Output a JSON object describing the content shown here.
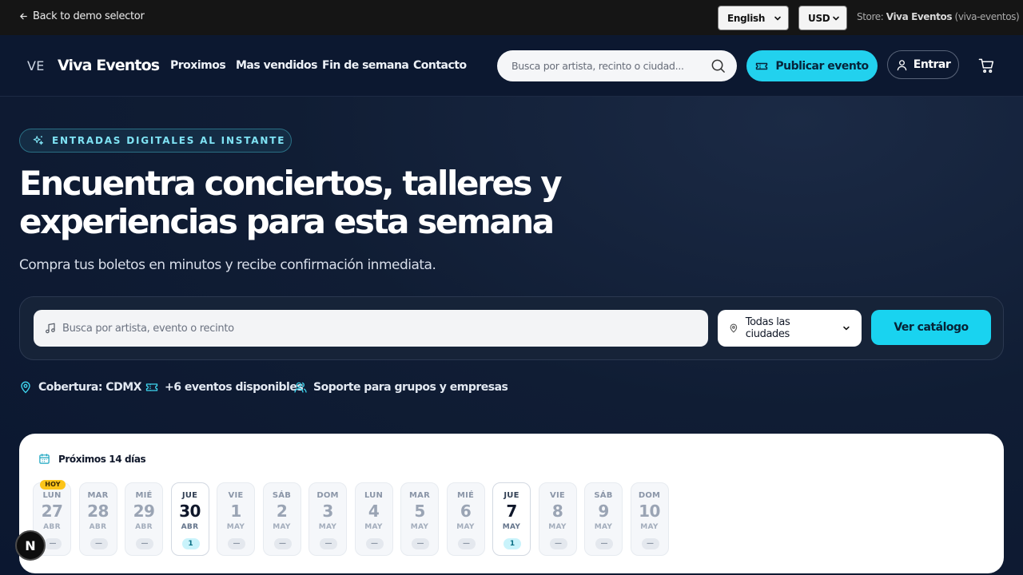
{
  "topbar": {
    "back_label": "Back to demo selector",
    "language": "English",
    "currency": "USD",
    "store_prefix": "Store:",
    "store_name": "Viva Eventos",
    "store_slug": "(viva-eventos)"
  },
  "navbar": {
    "logo_mark": "VE",
    "logo_name": "Viva Eventos",
    "links": [
      "Proximos",
      "Mas vendidos",
      "Fin de semana",
      "Contacto"
    ],
    "search_placeholder": "Busca por artista, recinto o ciudad...",
    "publish_label": "Publicar evento",
    "login_label": "Entrar"
  },
  "hero": {
    "badge": "ENTRADAS DIGITALES AL INSTANTE",
    "title_line1": "Encuentra conciertos, talleres y",
    "title_line2": "experiencias para esta semana",
    "subtitle": "Compra tus boletos en minutos y recibe confirmación inmediata.",
    "search_placeholder": "Busca por artista, evento o recinto",
    "city_selected": "Todas las ciudades",
    "catalog_label": "Ver catálogo",
    "info": [
      "Cobertura: CDMX",
      "+6 eventos disponibles",
      "Soporte para grupos y empresas"
    ]
  },
  "calendar": {
    "title": "Próximos 14 días",
    "today_label": "HOY",
    "days": [
      {
        "dow": "LUN",
        "num": "27",
        "mon": "ABR",
        "count": "—",
        "active": false,
        "today": true
      },
      {
        "dow": "MAR",
        "num": "28",
        "mon": "ABR",
        "count": "—",
        "active": false,
        "today": false
      },
      {
        "dow": "MIÉ",
        "num": "29",
        "mon": "ABR",
        "count": "—",
        "active": false,
        "today": false
      },
      {
        "dow": "JUE",
        "num": "30",
        "mon": "ABR",
        "count": "1",
        "active": true,
        "today": false
      },
      {
        "dow": "VIE",
        "num": "1",
        "mon": "MAY",
        "count": "—",
        "active": false,
        "today": false
      },
      {
        "dow": "SÁB",
        "num": "2",
        "mon": "MAY",
        "count": "—",
        "active": false,
        "today": false
      },
      {
        "dow": "DOM",
        "num": "3",
        "mon": "MAY",
        "count": "—",
        "active": false,
        "today": false
      },
      {
        "dow": "LUN",
        "num": "4",
        "mon": "MAY",
        "count": "—",
        "active": false,
        "today": false
      },
      {
        "dow": "MAR",
        "num": "5",
        "mon": "MAY",
        "count": "—",
        "active": false,
        "today": false
      },
      {
        "dow": "MIÉ",
        "num": "6",
        "mon": "MAY",
        "count": "—",
        "active": false,
        "today": false
      },
      {
        "dow": "JUE",
        "num": "7",
        "mon": "MAY",
        "count": "1",
        "active": true,
        "today": false
      },
      {
        "dow": "VIE",
        "num": "8",
        "mon": "MAY",
        "count": "—",
        "active": false,
        "today": false
      },
      {
        "dow": "SÁB",
        "num": "9",
        "mon": "MAY",
        "count": "—",
        "active": false,
        "today": false
      },
      {
        "dow": "DOM",
        "num": "10",
        "mon": "MAY",
        "count": "—",
        "active": false,
        "today": false
      }
    ]
  },
  "fab_label": "N",
  "colors": {
    "accent": "#22d1ee",
    "background": "#0e1a30",
    "today_badge": "#fcc419"
  }
}
